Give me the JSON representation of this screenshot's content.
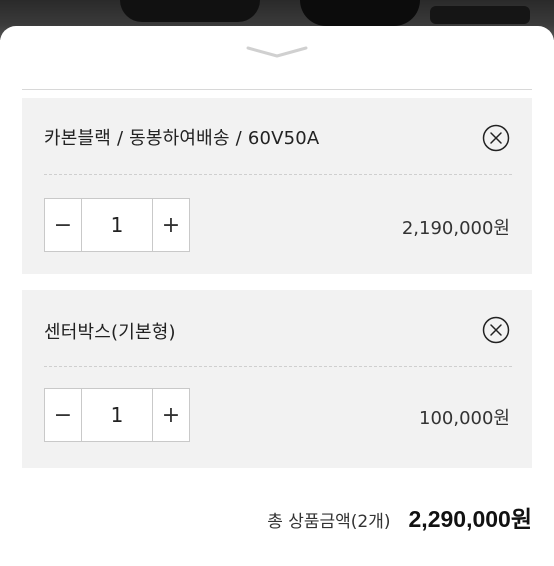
{
  "options": [
    {
      "name": "카본블랙 / 동봉하여배송 / 60V50A",
      "quantity": "1",
      "price": "2,190,000원"
    },
    {
      "name": "센터박스(기본형)",
      "quantity": "1",
      "price": "100,000원"
    }
  ],
  "stepper": {
    "minus": "−",
    "plus": "+"
  },
  "total": {
    "label": "총 상품금액(2개)",
    "amount": "2,290,000원"
  },
  "icons": {
    "handle": "chevron-down-icon",
    "remove": "close-circle-icon"
  }
}
